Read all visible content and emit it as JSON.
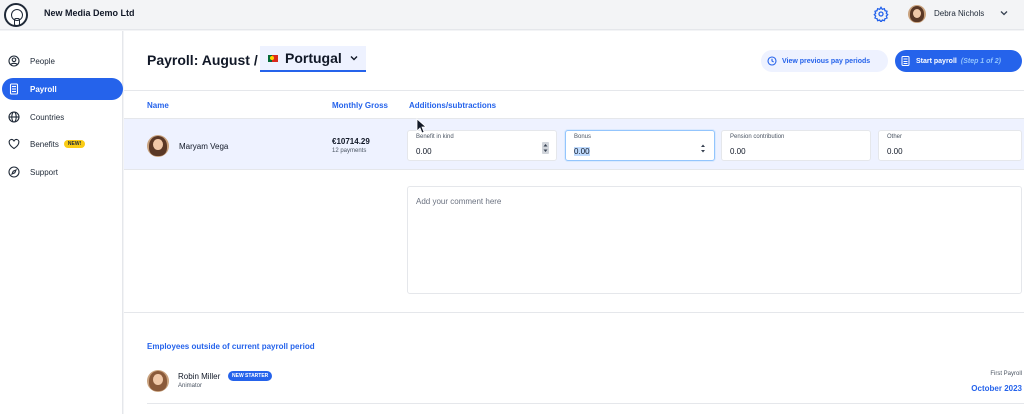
{
  "header": {
    "company": "New Media Demo Ltd",
    "user_name": "Debra Nichols"
  },
  "sidebar": {
    "items": [
      {
        "label": "People",
        "icon": "user-circle-icon"
      },
      {
        "label": "Payroll",
        "icon": "calculator-icon",
        "active": true
      },
      {
        "label": "Countries",
        "icon": "globe-icon"
      },
      {
        "label": "Benefits",
        "icon": "heart-icon",
        "badge": "NEW!"
      },
      {
        "label": "Support",
        "icon": "compass-icon"
      }
    ]
  },
  "page": {
    "title": "Payroll: August /",
    "country": "Portugal",
    "view_previous_label": "View previous pay periods",
    "start_payroll_label": "Start payroll",
    "start_payroll_step": "(Step 1 of 2)"
  },
  "columns": {
    "name": "Name",
    "gross": "Monthly Gross",
    "adjustments": "Additions/subtractions"
  },
  "employee": {
    "name": "Maryam Vega",
    "gross": "€10714.29",
    "payments": "12 payments",
    "fields": [
      {
        "label": "Benefit in kind",
        "value": "0.00"
      },
      {
        "label": "Bonus",
        "value": "0.00"
      },
      {
        "label": "Pension contribution",
        "value": "0.00"
      },
      {
        "label": "Other",
        "value": "0.00"
      }
    ],
    "comment_placeholder": "Add your comment here"
  },
  "outside": {
    "title": "Employees outside of current payroll period",
    "employee_name": "Robin Miller",
    "employee_role": "Animator",
    "badge": "NEW STARTER",
    "first_payroll_label": "First Payroll",
    "first_payroll_value": "October 2023"
  },
  "colors": {
    "accent": "#2563eb",
    "badge_new": "#facc15",
    "row_highlight": "#eef2ff"
  }
}
